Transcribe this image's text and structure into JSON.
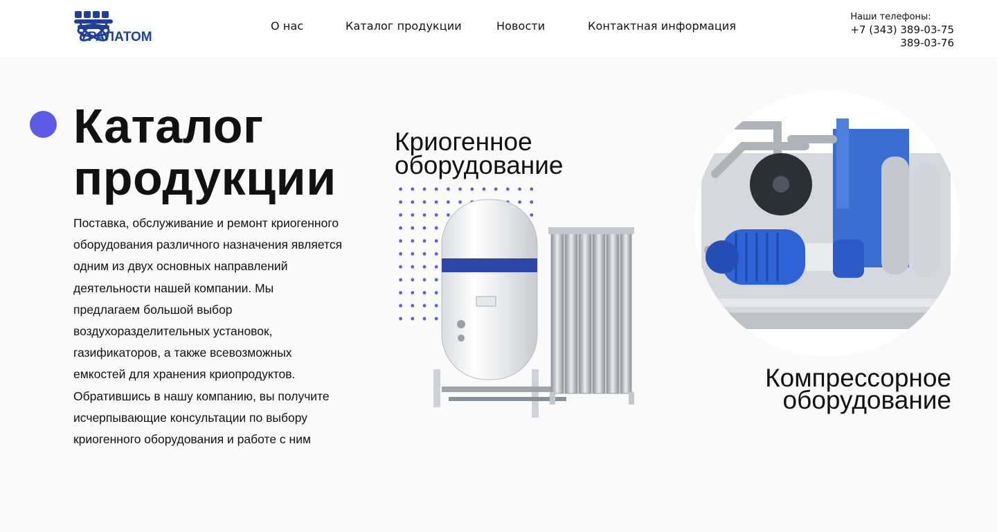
{
  "header": {
    "logo_alt": "УРАЛАТОМ",
    "nav": {
      "about": "О нас",
      "catalog": "Каталог продукции",
      "news": "Новости",
      "contacts": "Контактная информация"
    },
    "phones_label": "Наши телефоны:",
    "phone_1": "+7 (343) 389-03-75",
    "phone_2": "389-03-76"
  },
  "hero": {
    "title_line_1": "Каталог",
    "title_line_2": "продукции",
    "description": "Поставка, обслуживание и ремонт криогенного оборудования различного назначения является одним из двух основных направлений деятельности нашей компании. Мы предлагаем большой выбор воздухоразделительных установок, газификаторов, а также всевозможных емкостей для хранения криопродуктов. Обратившись в нашу компанию, вы получите исчерпывающие консультации по выбору криогенного оборудования и работе с ним"
  },
  "categories": {
    "cryogenic": {
      "line_1": "Криогенное",
      "line_2": "оборудование",
      "image_icon": "cryogenic-tank-icon"
    },
    "compressor": {
      "line_1": "Компрессорное",
      "line_2": "оборудование",
      "image_icon": "compressor-unit-icon"
    }
  },
  "colors": {
    "accent": "#5b5be8",
    "brand_blue": "#1f3f9a",
    "background": "#fafafa"
  }
}
